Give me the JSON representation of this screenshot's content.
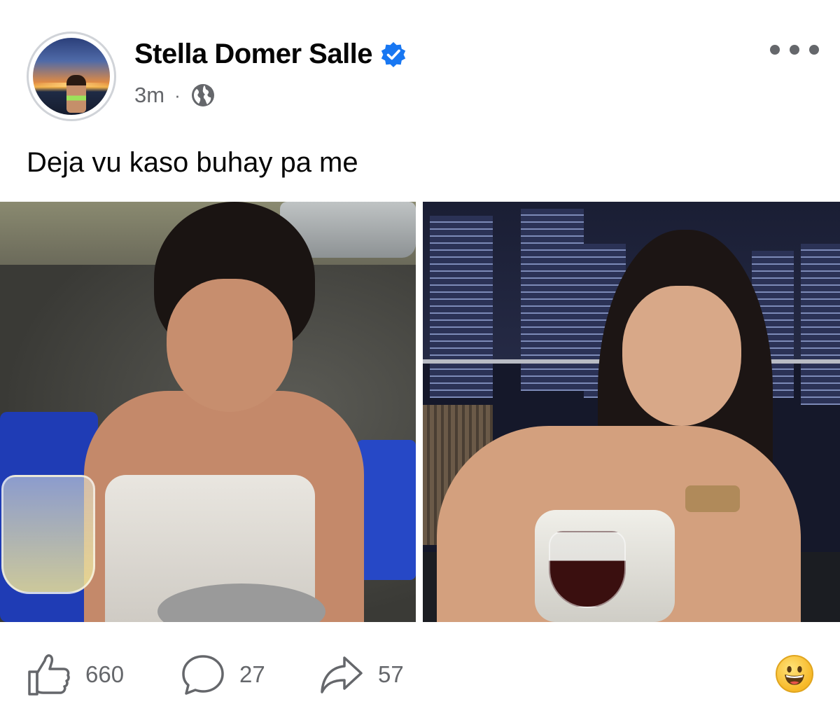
{
  "post": {
    "author": "Stella Domer Salle",
    "verified": true,
    "time": "3m",
    "separator": "·",
    "audience_icon": "globe-icon",
    "caption": "Deja vu kaso buhay pa me"
  },
  "photos": [
    {
      "name": "photo-left"
    },
    {
      "name": "photo-right"
    }
  ],
  "actions": {
    "like_count": "660",
    "comment_count": "27",
    "share_count": "57",
    "reaction_icon": "grinning-face-emoji"
  },
  "colors": {
    "verified_blue": "#1877f2",
    "meta_gray": "#65676b",
    "reaction_yellow": "#f7b928"
  }
}
